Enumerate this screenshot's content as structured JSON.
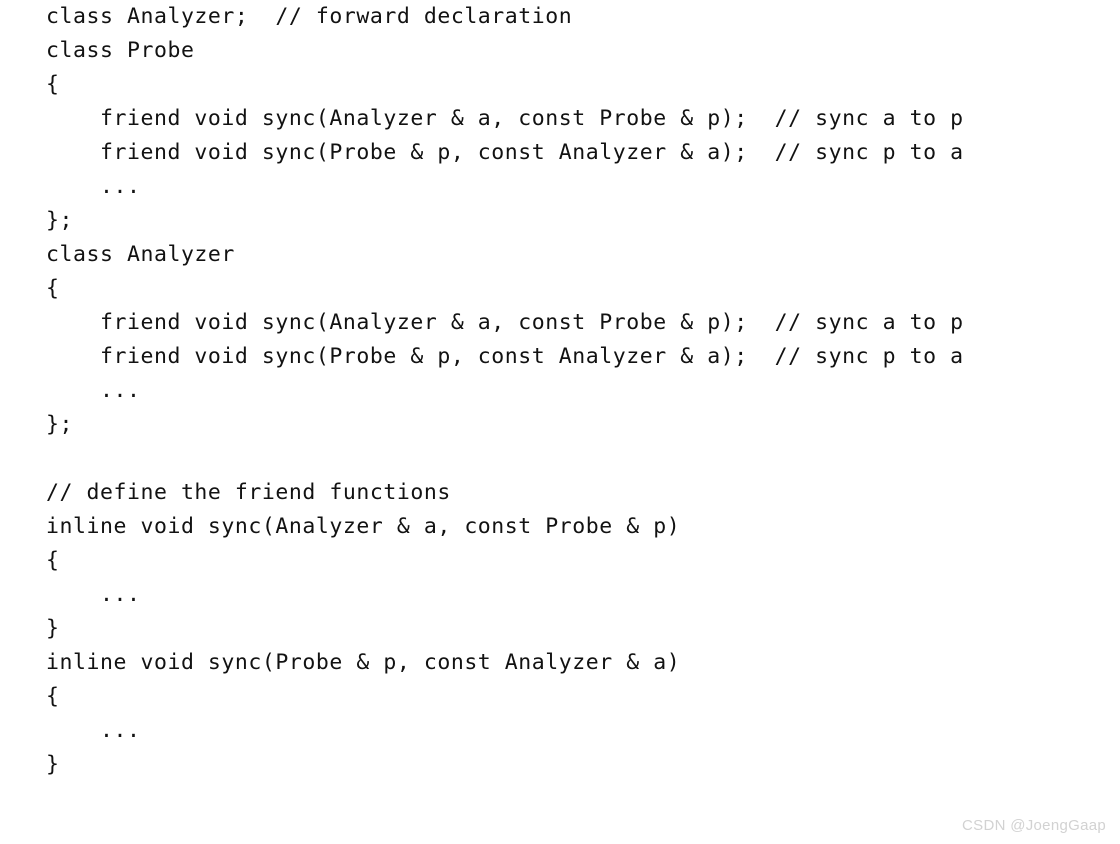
{
  "document": {
    "type": "scanned-code-listing",
    "language": "C++",
    "background_color": "#ffffff",
    "text_color": "#121212",
    "topic": "friend function declarations between Analyzer and Probe classes"
  },
  "code": {
    "lines": [
      "class Analyzer;  // forward declaration",
      "class Probe",
      "{",
      "    friend void sync(Analyzer & a, const Probe & p);  // sync a to p",
      "    friend void sync(Probe & p, const Analyzer & a);  // sync p to a",
      "    ...",
      "};",
      "class Analyzer",
      "{",
      "    friend void sync(Analyzer & a, const Probe & p);  // sync a to p",
      "    friend void sync(Probe & p, const Analyzer & a);  // sync p to a",
      "    ...",
      "};",
      "",
      "// define the friend functions",
      "inline void sync(Analyzer & a, const Probe & p)",
      "{",
      "    ...",
      "}",
      "inline void sync(Probe & p, const Analyzer & a)",
      "{",
      "    ...",
      "}"
    ]
  },
  "watermark": {
    "text": "CSDN @JoengGaap",
    "color": "#d2d2d2"
  }
}
